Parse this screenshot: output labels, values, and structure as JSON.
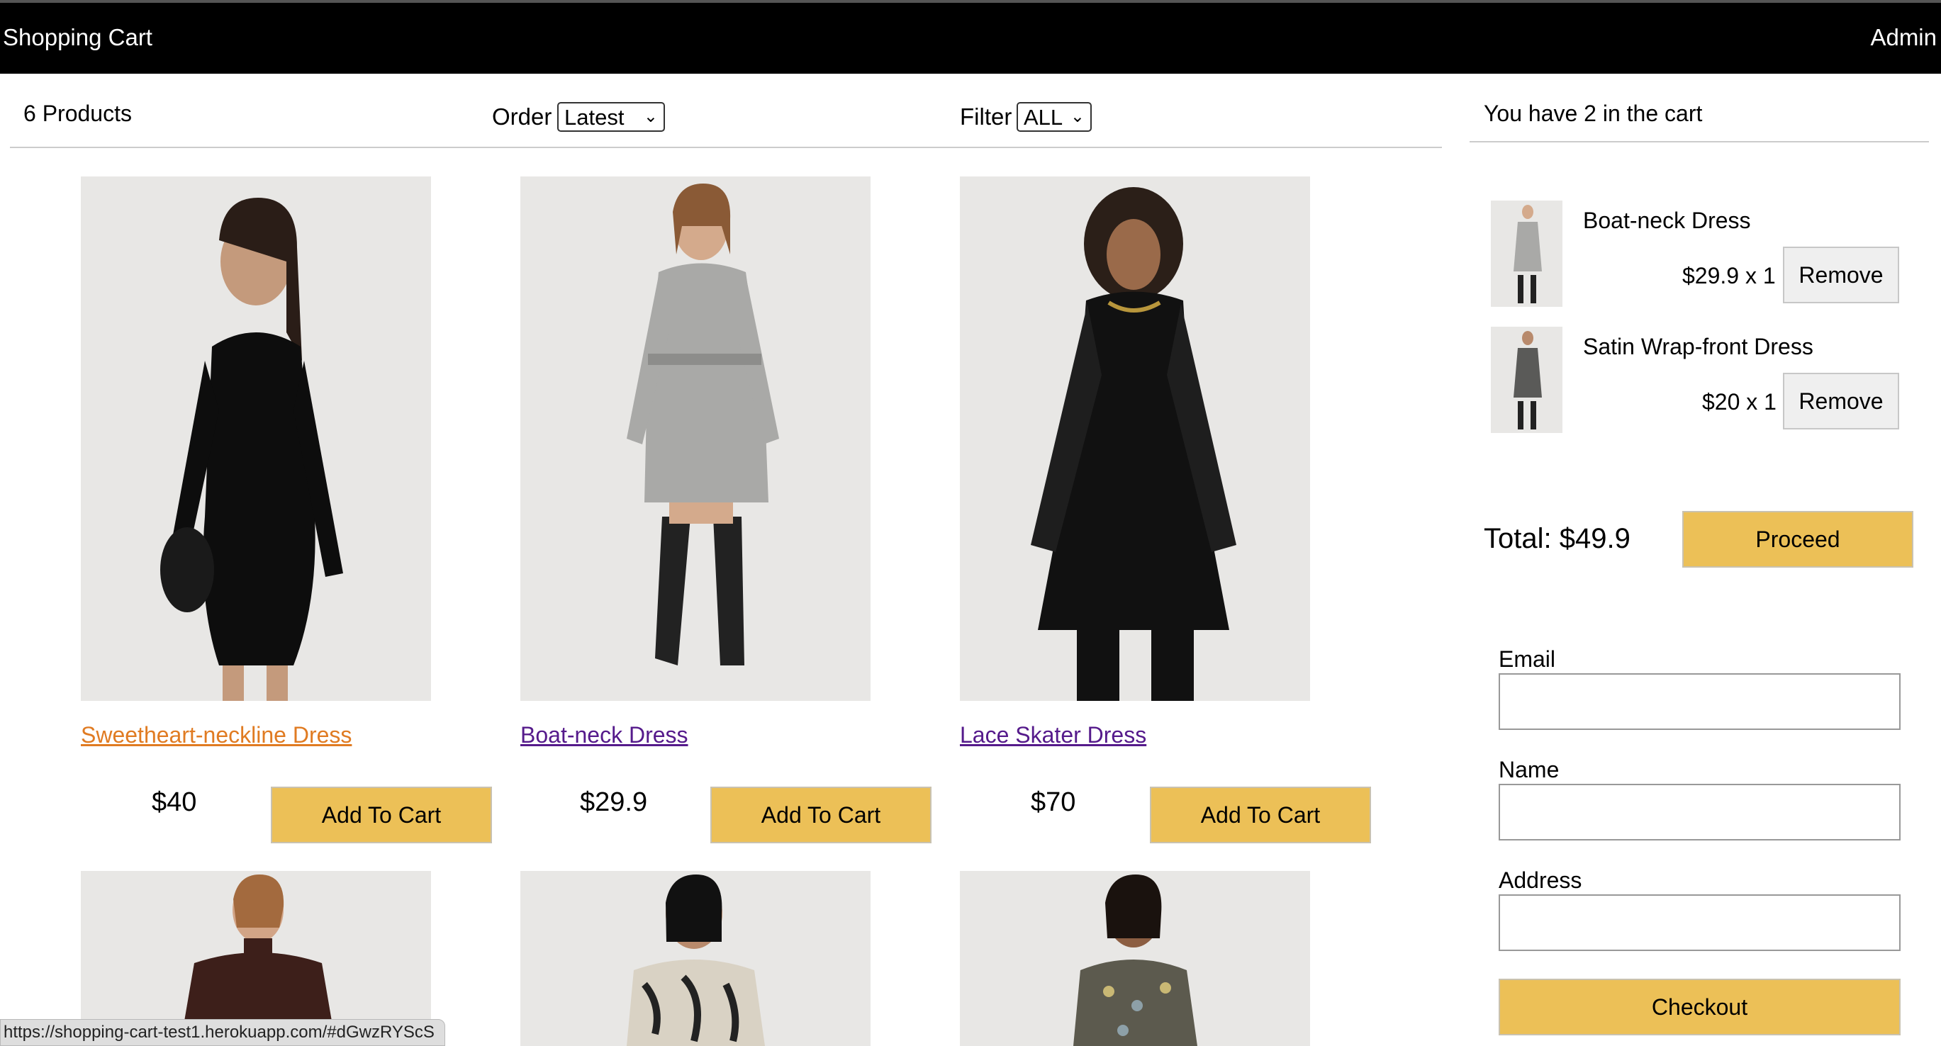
{
  "header": {
    "brand": "Shopping Cart",
    "user": "Admin"
  },
  "toolbar": {
    "count": "6 Products",
    "order_label": "Order",
    "order_value": "Latest",
    "filter_label": "Filter",
    "filter_value": "ALL"
  },
  "products": [
    {
      "title": "Sweetheart-neckline Dress",
      "price": "$40",
      "button": "Add To Cart"
    },
    {
      "title": "Boat-neck Dress",
      "price": "$29.9",
      "button": "Add To Cart"
    },
    {
      "title": "Lace Skater Dress",
      "price": "$70",
      "button": "Add To Cart"
    }
  ],
  "cart": {
    "summary": "You have 2 in the cart",
    "items": [
      {
        "name": "Boat-neck Dress",
        "qty": "$29.9 x 1",
        "remove": "Remove"
      },
      {
        "name": "Satin Wrap-front Dress",
        "qty": "$20 x 1",
        "remove": "Remove"
      }
    ],
    "total": "Total: $49.9",
    "proceed": "Proceed"
  },
  "form": {
    "email_label": "Email",
    "name_label": "Name",
    "address_label": "Address",
    "checkout": "Checkout"
  },
  "status_url": "https://shopping-cart-test1.herokuapp.com/#dGwzRYScS",
  "colors": {
    "accent": "#ecc057",
    "header_bg": "#000000",
    "visited_link": "#551a8b",
    "active_link": "#e07b22"
  },
  "icons": {
    "select_arrow": "chevron-down-icon"
  }
}
